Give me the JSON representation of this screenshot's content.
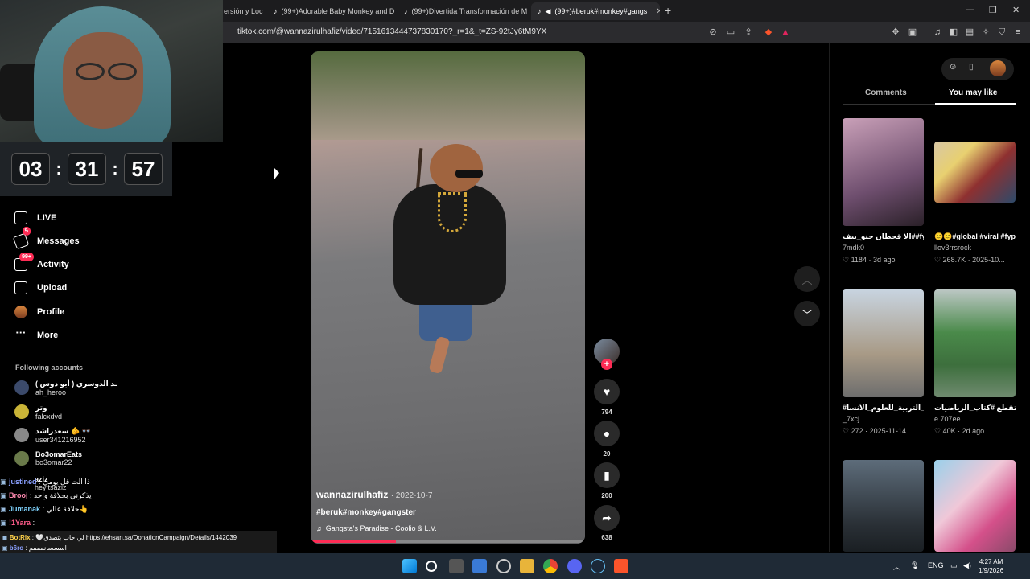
{
  "browser": {
    "tabs": [
      {
        "label": "ersión y Loc"
      },
      {
        "label": "(99+)Adorable Baby Monkey and Do"
      },
      {
        "label": "(99+)Divertida Transformación de M"
      },
      {
        "label": "(99+)#beruk#monkey#gangs"
      }
    ],
    "new_tab": "+",
    "url": "tiktok.com/@wannazirulhafiz/video/7151613444737830170?_r=1&_t=ZS-92tJy6tM9YX"
  },
  "stream_timer": {
    "hours": "03",
    "minutes": "31",
    "seconds": "57",
    "sep": ":"
  },
  "nav": [
    {
      "label": "LIVE",
      "icon": "live-icon"
    },
    {
      "label": "Messages",
      "icon": "send-icon",
      "badge": "5"
    },
    {
      "label": "Activity",
      "icon": "inbox-icon",
      "badge": "99+"
    },
    {
      "label": "Upload",
      "icon": "plus-box-icon"
    },
    {
      "label": "Profile",
      "icon": "avatar-icon"
    },
    {
      "label": "More",
      "icon": "more-icon"
    }
  ],
  "following": {
    "title": "Following accounts",
    "accounts": [
      {
        "name": "ـد الدوسري ( أبو دوس )",
        "user": "ah_heroo"
      },
      {
        "name": "وتر",
        "user": "falcxdvd"
      },
      {
        "name": "سعدراشد 🫵 👓",
        "user": "user341216952"
      },
      {
        "name": "Bo3omarEats",
        "user": "bo3omar22"
      },
      {
        "name": "aziz",
        "user": "heyitsaziz"
      }
    ]
  },
  "chat": [
    {
      "name": "justined",
      "msg": ": ذا الت قل يومي",
      "color": "#8aa0ff"
    },
    {
      "name": "Brooj",
      "msg": ": يذكرني بحلاقة واحد",
      "color": "#ff8ab0"
    },
    {
      "name": "Jumanak",
      "msg": ": حلاقة عالي👆",
      "color": "#7fd4ff"
    },
    {
      "name": "!1Yara",
      "msg": ":",
      "color": "#ff5c8a"
    }
  ],
  "chat_bottom": [
    {
      "name": "BotRlx",
      "msg": ": 🤍لي حاب يتصدق https://ehsan.sa/DonationCampaign/Details/1442039"
    },
    {
      "name": "b6ro",
      "msg": ": اسسسانمممم"
    }
  ],
  "video": {
    "username": "wannazirulhafiz",
    "date": "· 2022-10-7",
    "tags": "#beruk#monkey#gangster",
    "music": "Gangsta's Paradise - Coolio & L.V.",
    "progress": 0.31
  },
  "actions": {
    "likes": "794",
    "comments": "20",
    "saves": "200",
    "shares": "638"
  },
  "right_panel": {
    "tabs": [
      "Comments",
      "You may like"
    ],
    "active_tab": "You may like",
    "cards": [
      {
        "title": "الا قحطان جنو_بيف##fypppp...",
        "user": "7mdk0",
        "likes": "1184",
        "age": "3d ago"
      },
      {
        "title": "🙂🙂#global #viral #fyp...",
        "user": "llov3rrsrock",
        "likes": "268.7K",
        "age": "2025-10..."
      },
      {
        "title": "#جامعة_البصرة لية_التربية_للعلوم_الانسا...",
        "user": "_7xcj",
        "likes": "272",
        "age": "2025-11-14"
      },
      {
        "title": "مدلع ضربته ضربتين تقطع #كتاب_الرياضيات🤭...",
        "user": "e.707ee",
        "likes": "40K",
        "age": "2d ago"
      },
      {
        "title": "",
        "user": "",
        "likes": "",
        "age": ""
      },
      {
        "title": "",
        "user": "",
        "likes": "",
        "age": ""
      }
    ]
  },
  "taskbar": {
    "lang": "ENG",
    "time": "4:27 AM",
    "date": "1/9/2026"
  },
  "colors": {
    "accent": "#fe2c55",
    "bg": "#000000"
  }
}
